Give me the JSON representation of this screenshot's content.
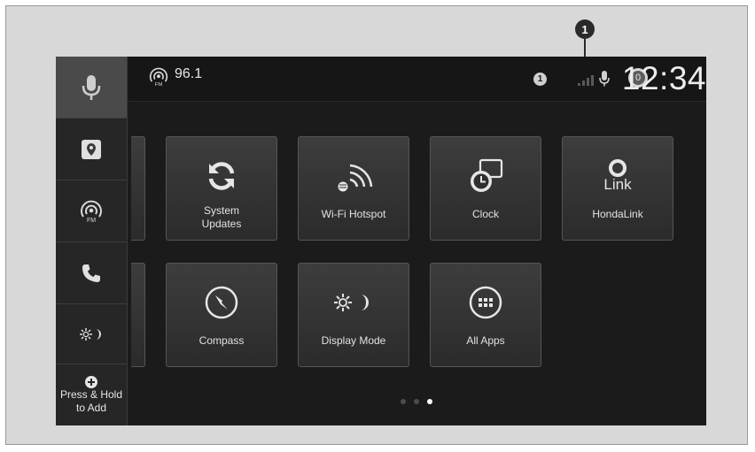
{
  "callout": {
    "number": "1"
  },
  "status_bar": {
    "radio_frequency": "96.1",
    "notification_count": "1",
    "highlighted_badge": "0",
    "clock": "12:34"
  },
  "sidebar": {
    "fm_label": "FM",
    "add_label_line1": "Press & Hold",
    "add_label_line2": "to Add"
  },
  "tiles": [
    {
      "label_line1": "System",
      "label_line2": "Updates",
      "icon": "refresh-icon"
    },
    {
      "label": "Wi-Fi Hotspot",
      "icon": "wifi-hotspot-icon"
    },
    {
      "label": "Clock",
      "icon": "clock-icon"
    },
    {
      "label": "HondaLink",
      "icon": "hondalink-icon",
      "icon_text": "Link"
    },
    {
      "label": "Compass",
      "icon": "compass-icon"
    },
    {
      "label": "Display Mode",
      "icon": "display-mode-icon"
    },
    {
      "label": "All Apps",
      "icon": "all-apps-icon"
    }
  ],
  "pager": {
    "pages": 3,
    "current": 3
  },
  "colors": {
    "screen_bg": "#1b1b1b",
    "tile_bg": "#333333",
    "text": "#e2e2e2"
  }
}
